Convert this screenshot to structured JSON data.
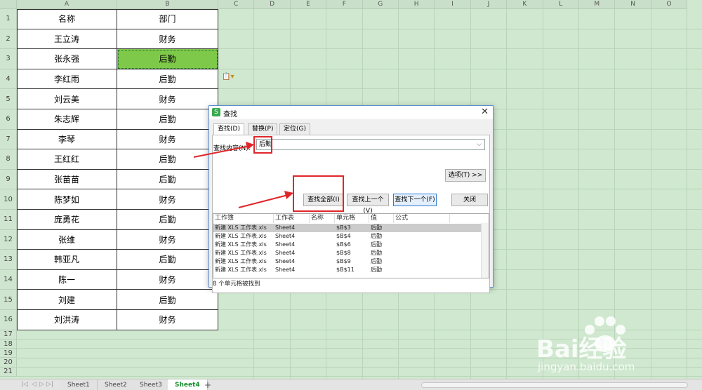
{
  "sheet": {
    "columns": [
      "A",
      "B",
      "C",
      "D",
      "E",
      "F",
      "G",
      "H",
      "I",
      "J",
      "K",
      "L",
      "M",
      "N",
      "O"
    ],
    "rows": [
      "1",
      "2",
      "3",
      "4",
      "5",
      "6",
      "7",
      "8",
      "9",
      "10",
      "11",
      "12",
      "13",
      "14",
      "15",
      "16",
      "17",
      "18",
      "19",
      "20",
      "21"
    ],
    "table": [
      [
        "名称",
        "部门"
      ],
      [
        "王立涛",
        "财务"
      ],
      [
        "张永强",
        "后勤"
      ],
      [
        "李红雨",
        "后勤"
      ],
      [
        "刘云美",
        "财务"
      ],
      [
        "朱志辉",
        "后勤"
      ],
      [
        "李琴",
        "财务"
      ],
      [
        "王红红",
        "后勤"
      ],
      [
        "张苗苗",
        "后勤"
      ],
      [
        "陈梦如",
        "财务"
      ],
      [
        "庞勇花",
        "后勤"
      ],
      [
        "张维",
        "财务"
      ],
      [
        "韩亚凡",
        "后勤"
      ],
      [
        "陈一",
        "财务"
      ],
      [
        "刘建",
        "后勤"
      ],
      [
        "刘洪涛",
        "财务"
      ]
    ],
    "selected_cell": "B3",
    "selected_row": 2
  },
  "sheet_tabs": [
    "Sheet1",
    "Sheet2",
    "Sheet3",
    "Sheet4"
  ],
  "active_tab": "Sheet4",
  "add_tab_label": "+",
  "dialog": {
    "title": "查找",
    "close_label": "✕",
    "tabs": [
      "查找(D)",
      "替换(P)",
      "定位(G)"
    ],
    "find_label": "查找内容(N):",
    "find_value": "后勤",
    "options_button": "选项(T) >>",
    "find_all_button": "查找全部(I)",
    "find_prev_button": "查找上一个(V)",
    "find_next_button": "查找下一个(F)",
    "close_button": "关闭",
    "result_headers": [
      "工作簿",
      "工作表",
      "名称",
      "单元格",
      "值",
      "公式"
    ],
    "results": [
      [
        "新建 XLS 工作表.xls",
        "Sheet4",
        "",
        "$B$3",
        "后勤",
        ""
      ],
      [
        "新建 XLS 工作表.xls",
        "Sheet4",
        "",
        "$B$4",
        "后勤",
        ""
      ],
      [
        "新建 XLS 工作表.xls",
        "Sheet4",
        "",
        "$B$6",
        "后勤",
        ""
      ],
      [
        "新建 XLS 工作表.xls",
        "Sheet4",
        "",
        "$B$8",
        "后勤",
        ""
      ],
      [
        "新建 XLS 工作表.xls",
        "Sheet4",
        "",
        "$B$9",
        "后勤",
        ""
      ],
      [
        "新建 XLS 工作表.xls",
        "Sheet4",
        "",
        "$B$11",
        "后勤",
        ""
      ]
    ],
    "status": "8 个单元格被找到"
  },
  "watermark": {
    "logo_text": "Bai经验",
    "url": "jingyan.baidu.com"
  },
  "colors": {
    "grid_bg": "#cfe8cf",
    "selected_cell": "#7fc94a",
    "active_tab_text": "#1a8c2e",
    "annotation_red": "#e0262a",
    "primary_button_border": "#2b7bd6"
  }
}
